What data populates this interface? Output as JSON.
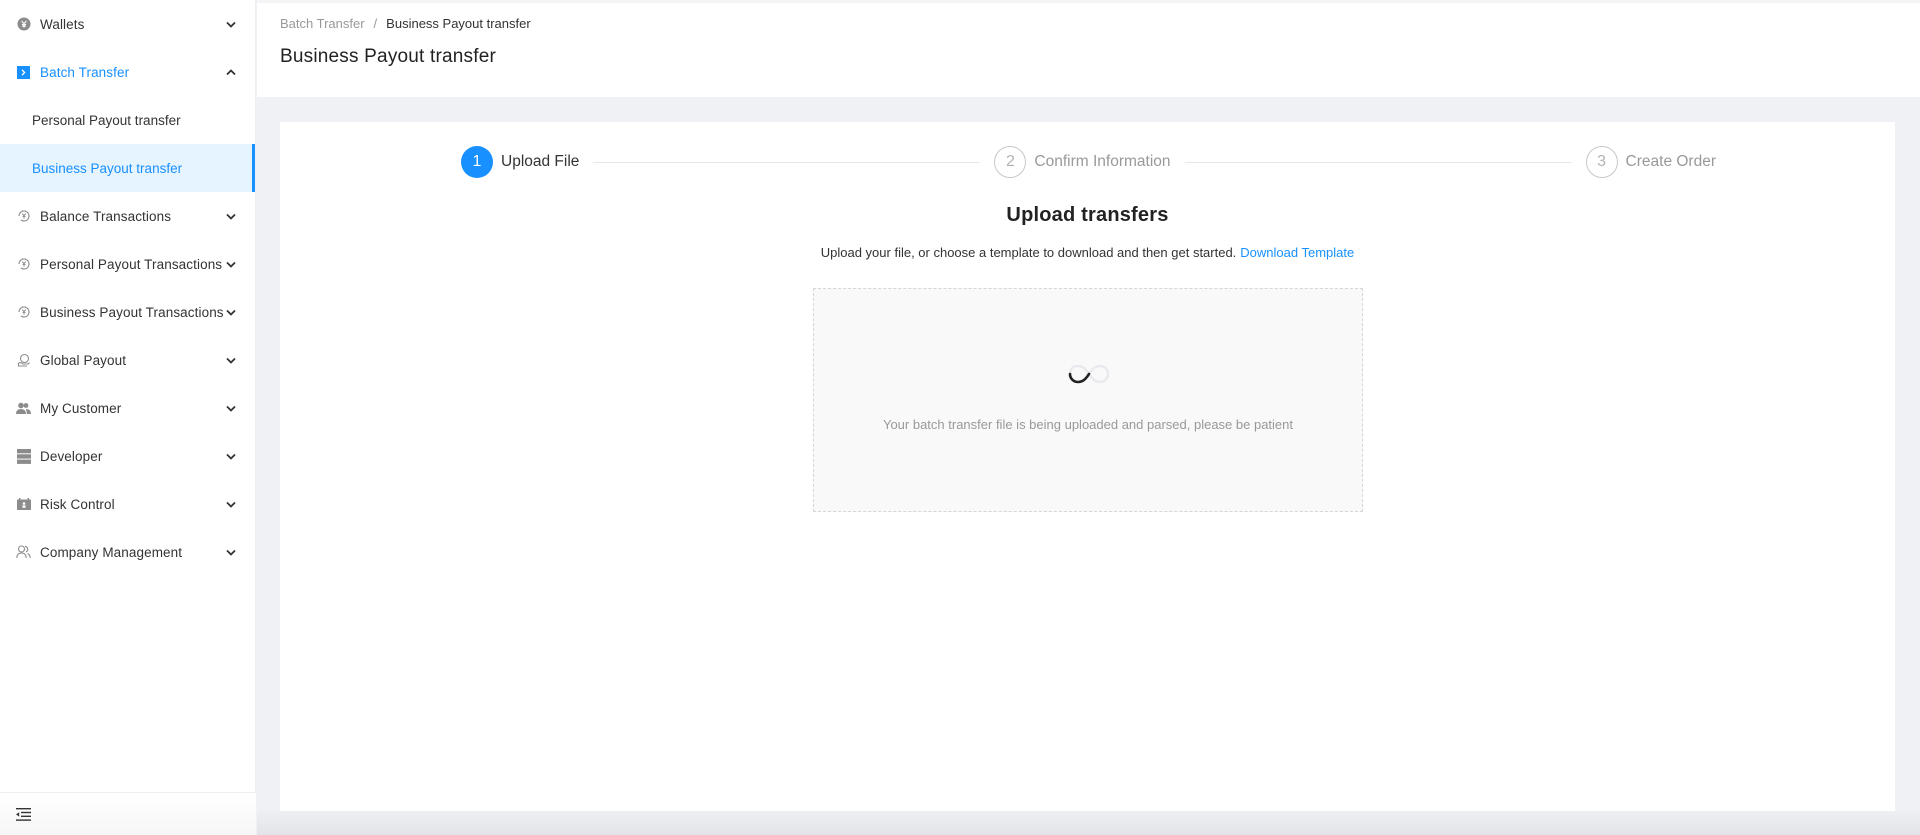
{
  "sidebar": {
    "items": [
      {
        "label": "Wallets",
        "icon": "wallet-icon",
        "expanded": false
      },
      {
        "label": "Batch Transfer",
        "icon": "batch-transfer-icon",
        "expanded": true,
        "children": [
          {
            "label": "Personal Payout transfer",
            "active": false
          },
          {
            "label": "Business Payout transfer",
            "active": true
          }
        ]
      },
      {
        "label": "Balance Transactions",
        "icon": "transactions-icon",
        "expanded": false
      },
      {
        "label": "Personal Payout Transactions",
        "icon": "transactions-icon",
        "expanded": false
      },
      {
        "label": "Business Payout Transactions",
        "icon": "transactions-icon",
        "expanded": false
      },
      {
        "label": "Global Payout",
        "icon": "global-payout-icon",
        "expanded": false
      },
      {
        "label": "My Customer",
        "icon": "customers-icon",
        "expanded": false
      },
      {
        "label": "Developer",
        "icon": "developer-icon",
        "expanded": false
      },
      {
        "label": "Risk Control",
        "icon": "risk-control-icon",
        "expanded": false
      },
      {
        "label": "Company Management",
        "icon": "company-icon",
        "expanded": false
      }
    ],
    "footer_icon": "collapse-menu-icon"
  },
  "header": {
    "breadcrumb": {
      "parent": "Batch Transfer",
      "separator": "/",
      "current": "Business Payout transfer"
    },
    "title": "Business Payout transfer"
  },
  "steps": [
    {
      "number": "1",
      "label": "Upload File",
      "status": "active"
    },
    {
      "number": "2",
      "label": "Confirm Information",
      "status": "wait"
    },
    {
      "number": "3",
      "label": "Create Order",
      "status": "wait"
    }
  ],
  "upload": {
    "title": "Upload transfers",
    "description": "Upload your file, or choose a template to download and then get started.",
    "download_link": "Download Template",
    "loading_text": "Your batch transfer file is being uploaded and parsed, please be patient"
  },
  "colors": {
    "accent": "#1890ff",
    "active_bg": "#e6f4ff",
    "page_bg": "#f0f1f4"
  }
}
